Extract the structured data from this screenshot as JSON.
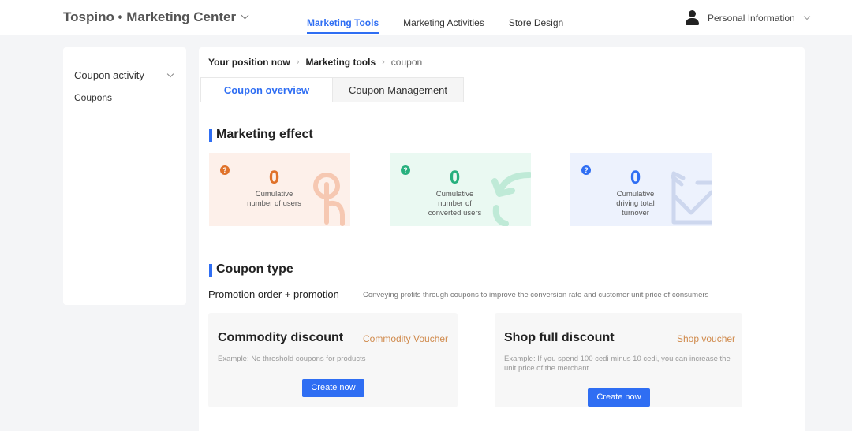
{
  "header": {
    "brand": "Tospino • Marketing Center",
    "nav": [
      "Marketing Tools",
      "Marketing Activities",
      "Store Design"
    ],
    "user_label": "Personal Information"
  },
  "sidebar": {
    "group_label": "Coupon activity",
    "items": [
      {
        "label": "Coupons"
      }
    ]
  },
  "breadcrumb": {
    "prefix": "Your position now",
    "level1": "Marketing tools",
    "current": "coupon"
  },
  "tabs": [
    {
      "label": "Coupon overview",
      "active": true
    },
    {
      "label": "Coupon Management",
      "active": false
    }
  ],
  "marketing_effect": {
    "title": "Marketing effect",
    "stats": [
      {
        "value": "0",
        "label": "Cumulative number of users",
        "color": "#e0722a",
        "bg": "#fdf0ea",
        "icon": "touch-icon"
      },
      {
        "value": "0",
        "label": "Cumulative number of converted users",
        "color": "#27b07e",
        "bg": "#eaf9f2",
        "icon": "convert-arrow-icon"
      },
      {
        "value": "0",
        "label": "Cumulative driving total turnover",
        "color": "#2f6ef3",
        "bg": "#edf2fd",
        "icon": "trend-chart-icon"
      }
    ]
  },
  "coupon_type": {
    "title": "Coupon type",
    "promo_title": "Promotion order + promotion",
    "promo_desc": "Conveying profits through coupons to improve the conversion rate and customer unit price of consumers",
    "cards": [
      {
        "title": "Commodity discount",
        "subtitle": "Commodity Voucher",
        "example": "Example: No threshold coupons for products",
        "button": "Create now"
      },
      {
        "title": "Shop full discount",
        "subtitle": "Shop voucher",
        "example": "Example: If you spend 100 cedi minus 10 cedi, you can increase the unit price of the merchant",
        "button": "Create now"
      }
    ]
  }
}
